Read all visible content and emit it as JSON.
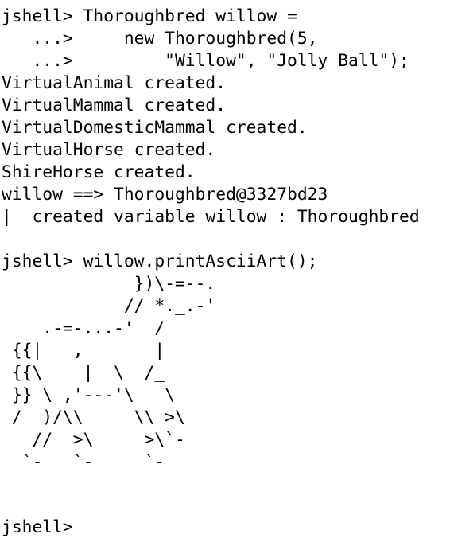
{
  "terminal": {
    "session1": [
      "jshell> Thoroughbred willow =",
      "   ...>     new Thoroughbred(5,",
      "   ...>         \"Willow\", \"Jolly Ball\");",
      "VirtualAnimal created.",
      "VirtualMammal created.",
      "VirtualDomesticMammal created.",
      "VirtualHorse created.",
      "ShireHorse created.",
      "willow ==> Thoroughbred@3327bd23",
      "|  created variable willow : Thoroughbred"
    ],
    "blank": "",
    "session2_command": "jshell> willow.printAsciiArt();",
    "ascii_art": [
      "             })\\-=--.",
      "            // *._.-'",
      "   _.-=-...-'  /",
      " {{|   ,       |",
      " {{\\    |  \\  /_",
      " }} \\ ,'---'\\___\\",
      " /  )/\\\\     \\\\ >\\",
      "   //  >\\     >\\`-",
      "  `-   `-     `-"
    ],
    "final_prompt": "jshell>"
  }
}
